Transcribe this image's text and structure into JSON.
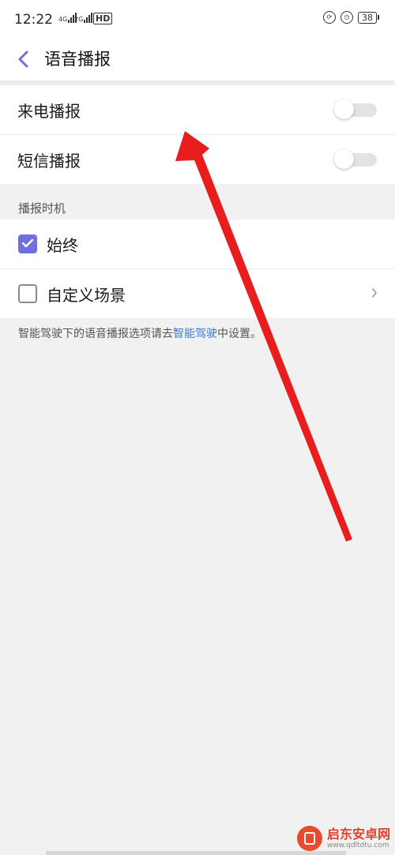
{
  "status_bar": {
    "time": "12:22",
    "signal1_label": "4G",
    "signal2_label": "2G",
    "hd_label": "HD",
    "battery": "38",
    "icons": [
      "lock-rotation-icon",
      "alarm-icon"
    ]
  },
  "header": {
    "title": "语音播报"
  },
  "call_sms_group": [
    {
      "label": "来电播报",
      "toggle_on": false
    },
    {
      "label": "短信播报",
      "toggle_on": false
    }
  ],
  "timing": {
    "section_title": "播报时机",
    "options": [
      {
        "label": "始终",
        "checked": true
      },
      {
        "label": "自定义场景",
        "checked": false
      }
    ]
  },
  "footer": {
    "prefix": "智能驾驶下的语音播报选项请去",
    "link": "智能驾驶",
    "suffix": "中设置。"
  },
  "watermark": {
    "name": "启东安卓网",
    "url": "www.qdltdtu.com"
  },
  "colors": {
    "accent": "#6f70e0",
    "link": "#3a7bd5",
    "annotation_arrow": "#e81d1d",
    "background": "#f1f1f1"
  }
}
